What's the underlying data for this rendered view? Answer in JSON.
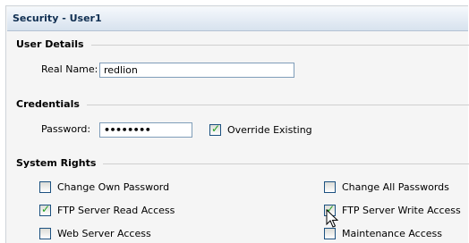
{
  "panel": {
    "title": "Security - User1"
  },
  "user_details": {
    "heading": "User Details",
    "real_name_label": "Real Name:",
    "real_name_value": "redlion"
  },
  "credentials": {
    "heading": "Credentials",
    "password_label": "Password:",
    "password_value": "••••••••",
    "override_label": "Override Existing",
    "override_checked": true
  },
  "system_rights": {
    "heading": "System Rights",
    "items": [
      {
        "label": "Change Own Password",
        "checked": false
      },
      {
        "label": "Change All Passwords",
        "checked": false
      },
      {
        "label": "FTP Server Read Access",
        "checked": true
      },
      {
        "label": "FTP Server Write Access",
        "checked": true
      },
      {
        "label": "Web Server Access",
        "checked": false
      },
      {
        "label": "Maintenance Access",
        "checked": false
      }
    ]
  },
  "colors": {
    "check_mark": "#21a121",
    "title_text": "#102f52"
  }
}
